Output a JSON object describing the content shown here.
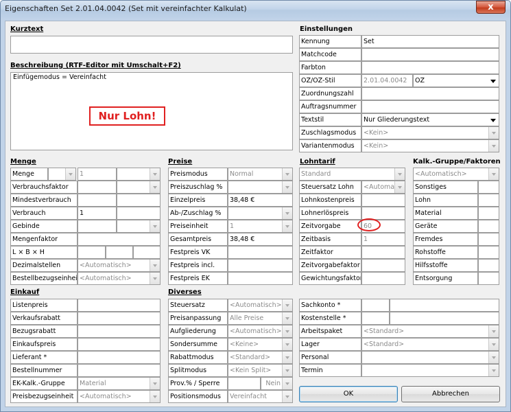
{
  "window": {
    "title": "Eigenschaften Set 2.01.04.0042 (Set mit vereinfachter Kalkulat)",
    "close_glyph": "x"
  },
  "kurztext": {
    "header": "Kurztext",
    "value": ""
  },
  "beschreibung": {
    "header": "Beschreibung (RTF-Editor mit Umschalt+F2)",
    "value": "Einfügemodus = Vereinfacht",
    "annotation": "Nur Lohn!"
  },
  "einstellungen": {
    "header": "Einstellungen",
    "kennung_label": "Kennung",
    "kennung_value": "Set",
    "matchcode_label": "Matchcode",
    "farbton_label": "Farbton",
    "ozstil_label": "OZ/OZ-Stil",
    "ozstil_value": "2.01.04.0042",
    "ozstil_select": "OZ",
    "zuordnungszahl_label": "Zuordnungszahl",
    "auftragsnummer_label": "Auftragsnummer",
    "textstil_label": "Textstil",
    "textstil_value": "Nur Gliederungstext",
    "zuschlagsmodus_label": "Zuschlagsmodus",
    "zuschlagsmodus_value": "<Kein>",
    "variantenmodus_label": "Variantenmodus",
    "variantenmodus_value": "<Kein>"
  },
  "menge": {
    "header": "Menge",
    "menge_label": "Menge",
    "menge_value": "1",
    "verbrauchsfaktor_label": "Verbrauchsfaktor",
    "mindestverbrauch_label": "Mindestverbrauch",
    "verbrauch_label": "Verbrauch",
    "verbrauch_value": "1",
    "gebinde_label": "Gebinde",
    "mengenfaktor_label": "Mengenfaktor",
    "lbh_label": "L × B × H",
    "dezimalstellen_label": "Dezimalstellen",
    "dezimalstellen_value": "<Automatisch>",
    "bestellbezug_label": "Bestellbezugseinheit",
    "bestellbezug_value": "<Automatisch>"
  },
  "preise": {
    "header": "Preise",
    "preismodus_label": "Preismodus",
    "preismodus_value": "Normal",
    "preiszuschlag_label": "Preiszuschlag %",
    "einzelpreis_label": "Einzelpreis",
    "einzelpreis_value": "38,48 €",
    "abzuschlag_label": "Ab-/Zuschlag %",
    "preiseinheit_label": "Preiseinheit",
    "preiseinheit_value": "1",
    "gesamtpreis_label": "Gesamtpreis",
    "gesamtpreis_value": "38,48 €",
    "festpreis_vk_label": "Festpreis VK",
    "festpreis_incl_label": "Festpreis incl.",
    "festpreis_ek_label": "Festpreis EK"
  },
  "lohntarif": {
    "header": "Lohntarif",
    "tarif_value": "Standard",
    "steuersatz_lohn_label": "Steuersatz Lohn",
    "steuersatz_lohn_value": "<Automat",
    "lohnkostenpreis_label": "Lohnkostenpreis",
    "lohnerloespreis_label": "Lohnerlöspreis",
    "zeitvorgabe_label": "Zeitvorgabe",
    "zeitvorgabe_value": "60",
    "zeitbasis_label": "Zeitbasis",
    "zeitbasis_value": "1",
    "zeitfaktor_label": "Zeitfaktor",
    "zeitvorgabefaktor_label": "Zeitvorgabefaktor",
    "gewichtungsfaktor_label": "Gewichtungsfaktor"
  },
  "kalk": {
    "header": "Kalk.-Gruppe/Faktoren",
    "gruppe_value": "<Automatisch>",
    "rows": [
      "Sonstiges",
      "Lohn",
      "Material",
      "Geräte",
      "Fremdes",
      "Rohstoffe",
      "Hilfsstoffe",
      "Entsorgung"
    ]
  },
  "einkauf": {
    "header": "Einkauf",
    "listenpreis_label": "Listenpreis",
    "verkaufsrabatt_label": "Verkaufsrabatt",
    "bezugsrabatt_label": "Bezugsrabatt",
    "einkaufspreis_label": "Einkaufspreis",
    "lieferant_label": "Lieferant *",
    "bestellnummer_label": "Bestellnummer",
    "ekgruppe_label": "EK-Kalk.-Gruppe",
    "ekgruppe_value": "Material",
    "preisbezug_label": "Preisbezugseinheit",
    "preisbezug_value": "<Automatisch>"
  },
  "diverses": {
    "header": "Diverses",
    "steuersatz_label": "Steuersatz",
    "steuersatz_value": "<Automatisch>",
    "preisanpassung_label": "Preisanpassung",
    "preisanpassung_value": "Alle Preise",
    "aufgliederung_label": "Aufgliederung",
    "aufgliederung_value": "<Automatisch>",
    "sondersumme_label": "Sondersumme",
    "sondersumme_value": "<Keine>",
    "rabattmodus_label": "Rabattmodus",
    "rabattmodus_value": "<Standard>",
    "splitmodus_label": "Splitmodus",
    "splitmodus_value": "<Kein Split>",
    "prov_label": "Prov.% / Sperre",
    "prov_sperre_value": "Nein",
    "positionsmodus_label": "Positionsmodus",
    "positionsmodus_value": "Vereinfacht"
  },
  "rechts": {
    "sachkonto_label": "Sachkonto *",
    "kostenstelle_label": "Kostenstelle *",
    "arbeitspaket_label": "Arbeitspaket",
    "arbeitspaket_value": "<Standard>",
    "lager_label": "Lager",
    "lager_value": "<Standard>",
    "personal_label": "Personal",
    "termin_label": "Termin"
  },
  "buttons": {
    "ok": "OK",
    "abbrechen": "Abbrechen"
  }
}
